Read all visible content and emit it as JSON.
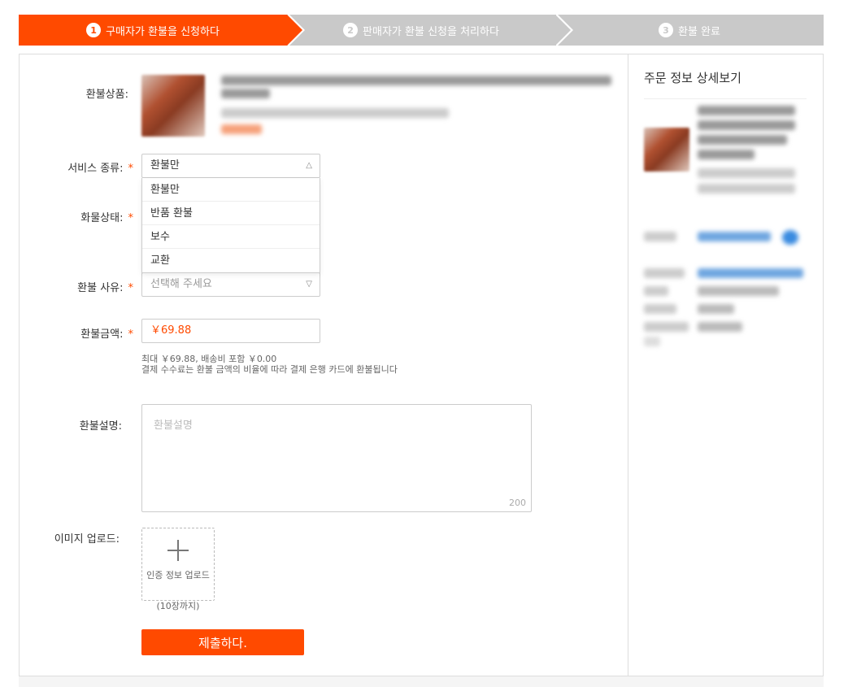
{
  "steps": [
    {
      "num": "1",
      "label": "구매자가 환불을 신청하다"
    },
    {
      "num": "2",
      "label": "판매자가 환불 신청을 처리하다"
    },
    {
      "num": "3",
      "label": "환불 완료"
    }
  ],
  "colors": {
    "accent": "#ff4a00",
    "inactive_step": "#c9c9c9"
  },
  "form": {
    "product_label": "환불상품:",
    "service_type_label": "서비스 종류:",
    "service_type_value": "환불만",
    "service_type_options": [
      "환불만",
      "반품 환불",
      "보수",
      "교환"
    ],
    "goods_status_label": "화물상태:",
    "reason_label": "환불 사유:",
    "reason_placeholder": "선택해 주세요",
    "amount_label": "환불금액:",
    "amount_value": "￥69.88",
    "amount_hint_1": "최대 ￥69.88, 배송비 포함 ￥0.00",
    "amount_hint_2": "결제 수수료는 환불 금액의 비율에 따라 결제 은행 카드에 환불됩니다",
    "description_label": "환불설명:",
    "description_placeholder": "환불설명",
    "description_counter": "200",
    "upload_label": "이미지 업로드:",
    "upload_text": "인증 정보 업로드",
    "upload_limit": "(10장까지)",
    "submit_label": "제출하다.",
    "required_mark": "*"
  },
  "sidebar": {
    "title": "주문 정보 상세보기"
  }
}
